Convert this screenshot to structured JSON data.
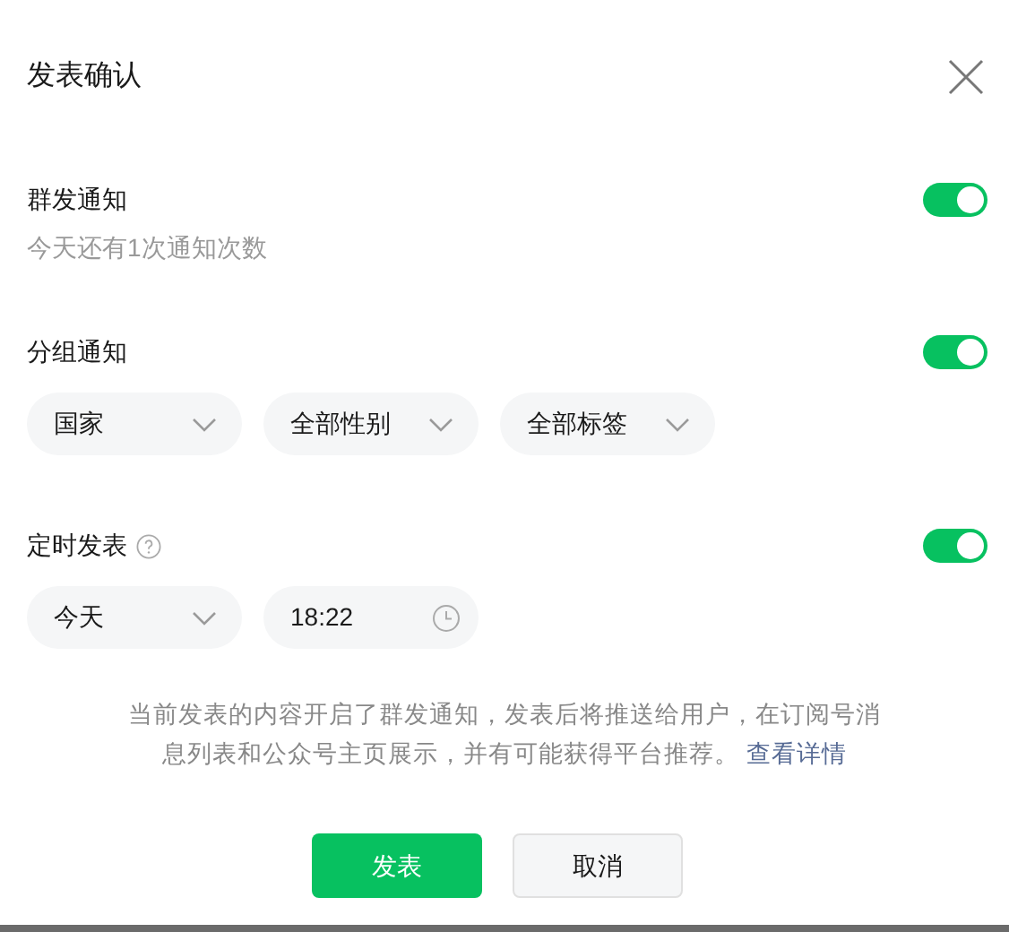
{
  "dialog": {
    "title": "发表确认"
  },
  "sections": [
    {
      "kind": "mass",
      "label": "群发通知",
      "on": true,
      "note": "今天还有1次通知次数"
    },
    {
      "kind": "group",
      "label": "分组通知",
      "on": true,
      "selects": [
        "国家",
        "全部性别",
        "全部标签"
      ]
    },
    {
      "kind": "schedule",
      "label": "定时发表",
      "help": true,
      "on": true,
      "date": "今天",
      "time": "18:22"
    }
  ],
  "notice": {
    "text": "当前发表的内容开启了群发通知，发表后将推送给用户，在订阅号消息列表和公众号主页展示，并有可能获得平台推荐。",
    "link": "查看详情"
  },
  "buttons": [
    {
      "label": "发表",
      "primary": true
    },
    {
      "label": "取消",
      "primary": false
    }
  ]
}
